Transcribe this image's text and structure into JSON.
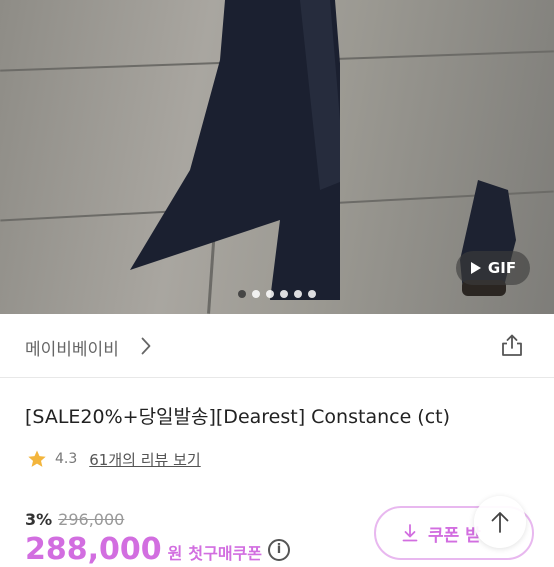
{
  "hero": {
    "gif_label": "GIF",
    "dots_total": 6,
    "active_dot": 1
  },
  "shop": {
    "name": "메이비베이비"
  },
  "product": {
    "title": "[SALE20%+당일발송][Dearest] Constance (ct)",
    "rating": "4.3",
    "reviews_label": "61개의 리뷰 보기"
  },
  "pricing": {
    "discount": "3%",
    "original_price": "296,000",
    "price": "288,000",
    "currency": "원",
    "coupon_label": "첫구매쿠폰",
    "info_glyph": "i"
  },
  "coupon_button": {
    "label": "쿠폰 받"
  },
  "colors": {
    "accent": "#d26ee0",
    "star": "#f3b53c"
  }
}
